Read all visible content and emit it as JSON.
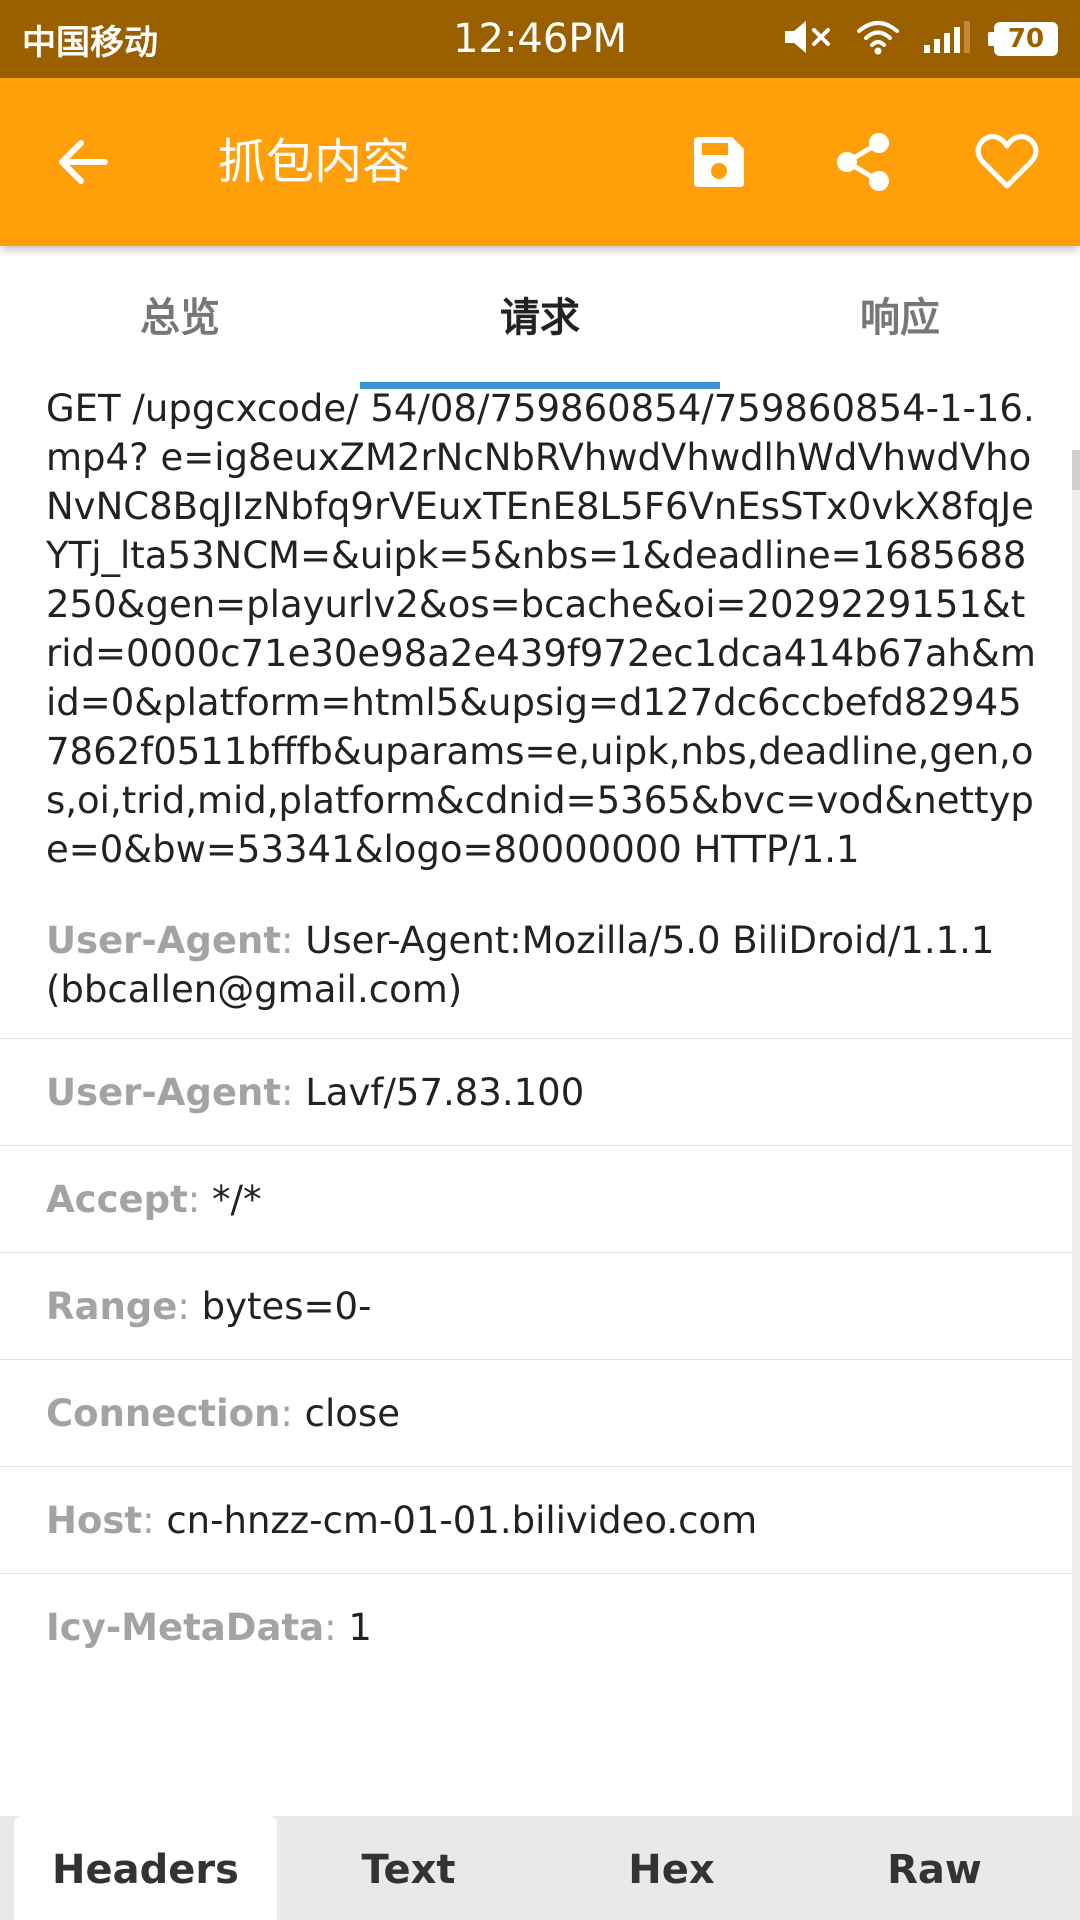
{
  "status_bar": {
    "carrier": "中国移动",
    "time": "12:46PM",
    "battery": "70"
  },
  "app_bar": {
    "title": "抓包内容",
    "back_icon": "arrow-back-icon",
    "save_icon": "save-icon",
    "share_icon": "share-icon",
    "favorite_icon": "heart-icon"
  },
  "tabs": [
    {
      "label": "总览"
    },
    {
      "label": "请求"
    },
    {
      "label": "响应"
    }
  ],
  "active_tab": "请求",
  "request_line": "GET /upgcxcode/ 54/08/759860854/759860854-1-16.mp4? e=ig8euxZM2rNcNbRVhwdVhwdlhWdVhwdVhoNvNC8BqJIzNbfq9rVEuxTEnE8L5F6VnEsSTx0vkX8fqJeYTj_lta53NCM=&uipk=5&nbs=1&deadline=1685688250&gen=playurlv2&os=bcache&oi=2029229151&trid=0000c71e30e98a2e439f972ec1dca414b67ah&mid=0&platform=html5&upsig=d127dc6ccbefd829457862f0511bfffb&uparams=e,uipk,nbs,deadline,gen,os,oi,trid,mid,platform&cdnid=5365&bvc=vod&nettype=0&bw=53341&logo=80000000 HTTP/1.1",
  "headers": [
    {
      "name": "User-Agent",
      "value": "User-Agent:Mozilla/5.0 BiliDroid/1.1.1 (bbcallen@gmail.com)"
    },
    {
      "name": "User-Agent",
      "value": "Lavf/57.83.100"
    },
    {
      "name": "Accept",
      "value": "*/*"
    },
    {
      "name": "Range",
      "value": "bytes=0-"
    },
    {
      "name": "Connection",
      "value": "close"
    },
    {
      "name": "Host",
      "value": "cn-hnzz-cm-01-01.bilivideo.com"
    },
    {
      "name": "Icy-MetaData",
      "value": "1"
    }
  ],
  "bottom_tabs": [
    {
      "label": "Headers"
    },
    {
      "label": "Text"
    },
    {
      "label": "Hex"
    },
    {
      "label": "Raw"
    }
  ],
  "active_bottom_tab": "Headers",
  "colors": {
    "status_bar": "#9a6000",
    "app_bar": "#ff9f0a",
    "tab_indicator": "#3a95d3",
    "header_name": "#a3a3a3"
  }
}
